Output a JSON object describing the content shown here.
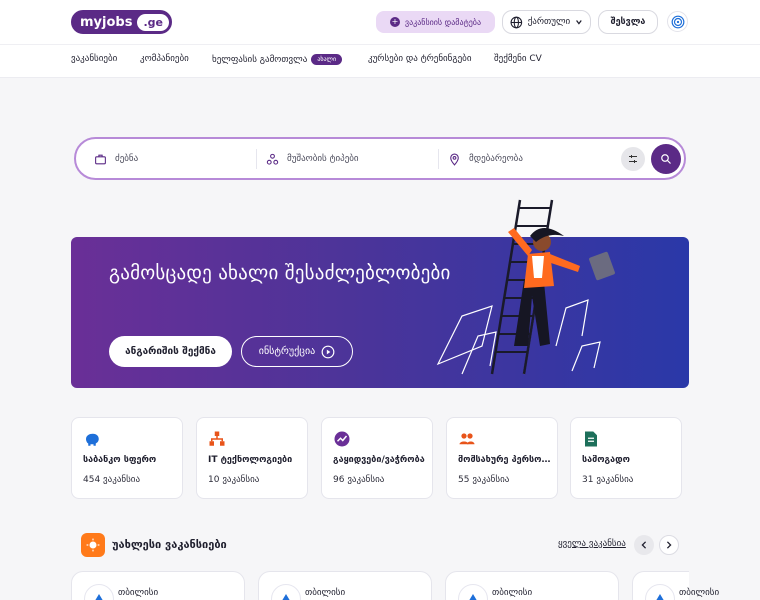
{
  "header": {
    "logo_main": "myjobs",
    "logo_domain": ".ge",
    "post_vacancy": "ვაკანსიის დამატება",
    "language": "ქართული",
    "login": "შესვლა"
  },
  "nav": [
    {
      "label": "ვაკანსიები"
    },
    {
      "label": "კომპანიები"
    },
    {
      "label": "ხელფასის გამოთვლა",
      "badge": "ახალი"
    },
    {
      "label": "კურსები და ტრენინგები"
    },
    {
      "label": "შექმენი CV"
    }
  ],
  "search": {
    "keyword_placeholder": "ძებნა",
    "worktype_placeholder": "მუშაობის ტიპები",
    "location_placeholder": "მდებარეობა"
  },
  "banner": {
    "title": "გამოსცადე ახალი შესაძლებლობები",
    "create_account": "ანგარიშის შექმნა",
    "instruction": "ინსტრუქცია"
  },
  "categories": [
    {
      "name": "საბანკო სფერო",
      "count": "454 ვაკანსია",
      "icon": "piggy-bank-icon"
    },
    {
      "name": "IT ტექნოლოგიები",
      "count": "10 ვაკანსია",
      "icon": "network-icon"
    },
    {
      "name": "გაყიდვები/ვაჭრობა",
      "count": "96 ვაკანსია",
      "icon": "trend-chart-icon"
    },
    {
      "name": "მომსახურე პერსონალი",
      "count": "55 ვაკანსია",
      "icon": "people-icon"
    },
    {
      "name": "სამოგადო",
      "count": "31 ვაკანსია",
      "icon": "document-icon"
    }
  ],
  "latest": {
    "title": "უახლესი ვაკანსიები",
    "all_link": "ყველა ვაკანსია",
    "jobs": [
      {
        "city": "თბილისი"
      },
      {
        "city": "თბილისი"
      },
      {
        "city": "თბილისი"
      },
      {
        "city": "თბილისი"
      }
    ]
  },
  "colors": {
    "brand": "#5b2a86",
    "accent_orange": "#ff7a1a",
    "link_blue": "#1e6fd9"
  }
}
